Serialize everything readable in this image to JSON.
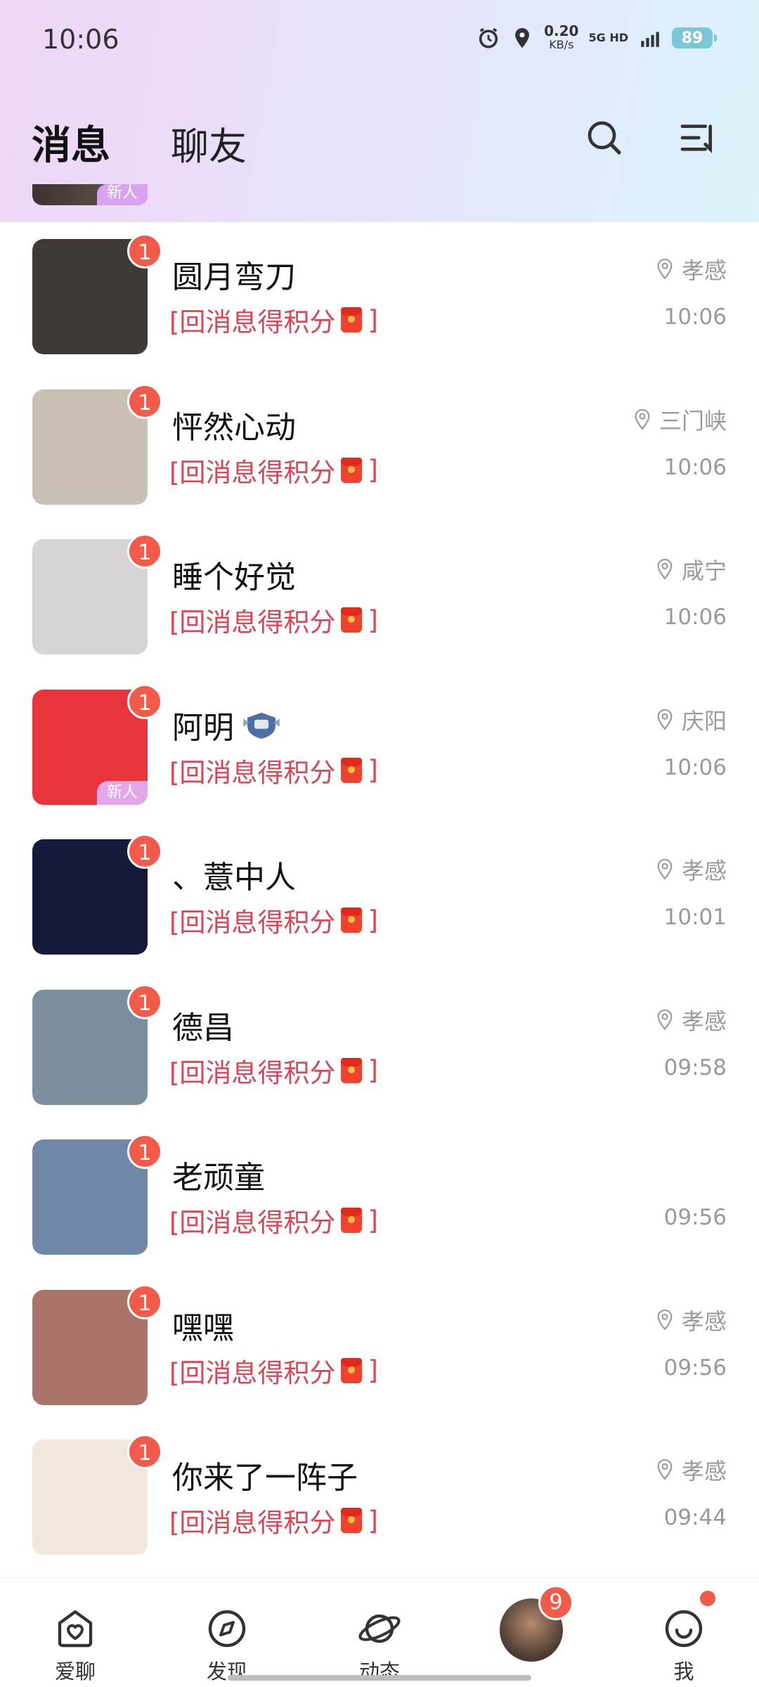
{
  "status_bar": {
    "time": "10:06",
    "speed_value": "0.20",
    "speed_unit": "KB/s",
    "network": "5G HD",
    "battery": "89"
  },
  "header": {
    "tab_messages": "消息",
    "tab_friends": "聊友",
    "accent_color": "#b77bf0"
  },
  "partial_row": {
    "new_badge": "新人"
  },
  "conversations": [
    {
      "name": "圆月弯刀",
      "unread": "1",
      "reward": "[回消息得积分",
      "reward_end": "]",
      "location": "孝感",
      "time": "10:06",
      "avatar_color": "#3f3a36",
      "new_badge": ""
    },
    {
      "name": "怦然心动",
      "unread": "1",
      "reward": "[回消息得积分",
      "reward_end": "]",
      "location": "三门峡",
      "time": "10:06",
      "avatar_color": "#c9c0b6",
      "new_badge": ""
    },
    {
      "name": "睡个好觉",
      "unread": "1",
      "reward": "[回消息得积分",
      "reward_end": "]",
      "location": "咸宁",
      "time": "10:06",
      "avatar_color": "#d8d3d4",
      "new_badge": ""
    },
    {
      "name": "阿明",
      "unread": "1",
      "reward": "[回消息得积分",
      "reward_end": "]",
      "location": "庆阳",
      "time": "10:06",
      "avatar_color": "#e8343a",
      "new_badge": "新人"
    },
    {
      "name": "、薏中人",
      "unread": "1",
      "reward": "[回消息得积分",
      "reward_end": "]",
      "location": "孝感",
      "time": "10:01",
      "avatar_color": "#141a3a",
      "new_badge": ""
    },
    {
      "name": "德昌",
      "unread": "1",
      "reward": "[回消息得积分",
      "reward_end": "]",
      "location": "孝感",
      "time": "09:58",
      "avatar_color": "#7d8f9e",
      "new_badge": ""
    },
    {
      "name": "老顽童",
      "unread": "1",
      "reward": "[回消息得积分",
      "reward_end": "]",
      "location": "",
      "time": "09:56",
      "avatar_color": "#6f87a8",
      "new_badge": ""
    },
    {
      "name": "嘿嘿",
      "unread": "1",
      "reward": "[回消息得积分",
      "reward_end": "]",
      "location": "孝感",
      "time": "09:56",
      "avatar_color": "#a9746a",
      "new_badge": ""
    },
    {
      "name": "你来了一阵子",
      "unread": "1",
      "reward": "[回消息得积分",
      "reward_end": "]",
      "location": "孝感",
      "time": "09:44",
      "avatar_color": "#f2e7dc",
      "new_badge": ""
    }
  ],
  "bottom_nav": {
    "items": [
      {
        "label": "爱聊",
        "icon": "heart-home-icon"
      },
      {
        "label": "发现",
        "icon": "compass-icon"
      },
      {
        "label": "动态",
        "icon": "planet-icon"
      },
      {
        "label": "",
        "icon": "avatar"
      },
      {
        "label": "我",
        "icon": "smile-icon"
      }
    ],
    "center_badge": "9"
  }
}
